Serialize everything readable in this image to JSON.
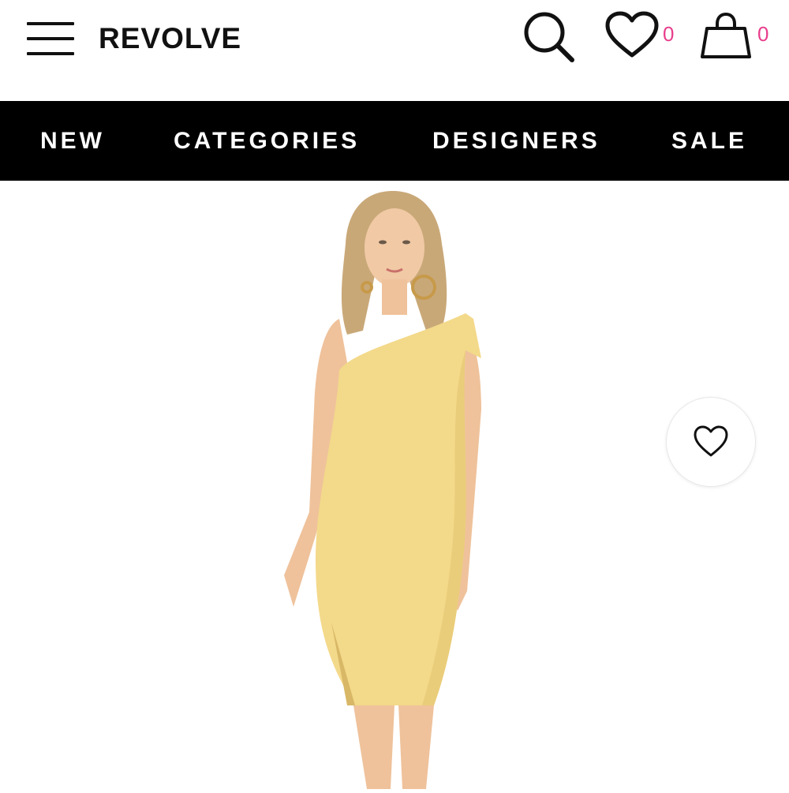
{
  "header": {
    "logo": "REVOLVE",
    "icons": {
      "menu": "hamburger-menu-icon",
      "search": "search-icon",
      "wishlist": "heart-icon",
      "cart": "shopping-bag-icon"
    },
    "wishlist_count": "0",
    "cart_count": "0",
    "count_color": "#e83e8c"
  },
  "nav": {
    "items": [
      {
        "label": "NEW"
      },
      {
        "label": "CATEGORIES"
      },
      {
        "label": "DESIGNERS"
      },
      {
        "label": "SALE"
      }
    ],
    "background": "#000000",
    "text_color": "#ffffff"
  },
  "product": {
    "image": {
      "description_icon": "product-photo",
      "dress_color": "#f3d98a"
    },
    "favorite_icon": "heart-icon"
  }
}
